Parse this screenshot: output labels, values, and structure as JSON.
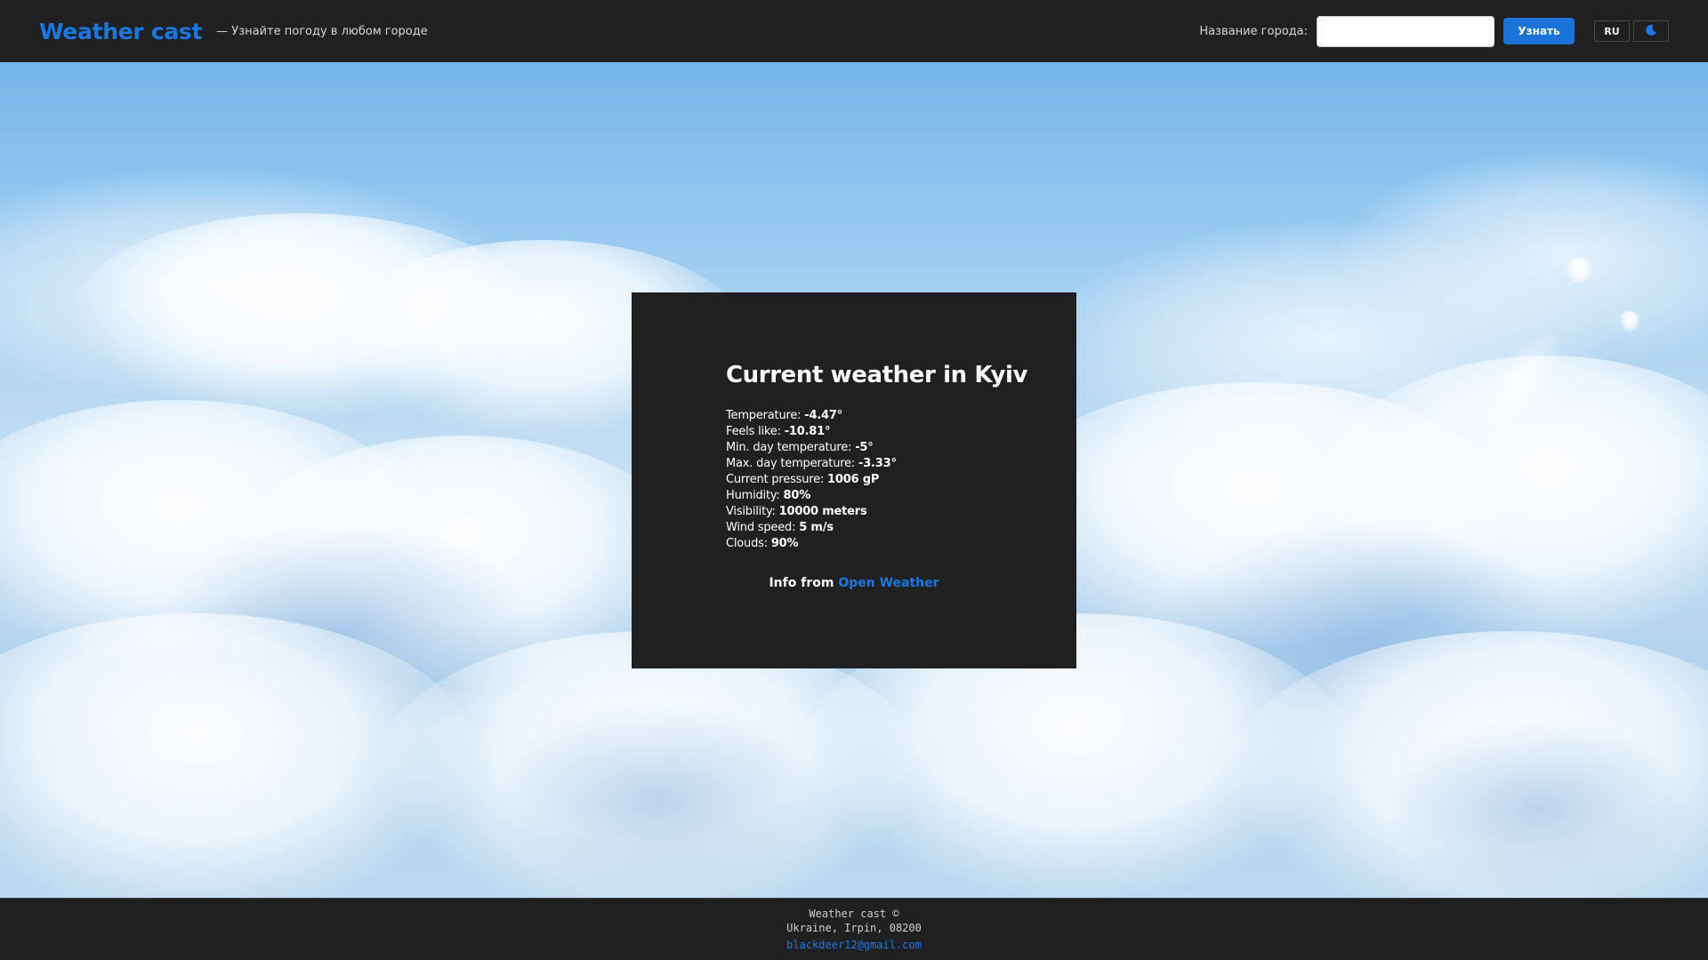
{
  "header": {
    "brand": "Weather cast",
    "tagline": "— Узнайте погоду в любом городе",
    "city_label": "Название города:",
    "city_input_value": "",
    "city_input_placeholder": "",
    "submit_label": "Узнать",
    "lang_label": "RU",
    "theme_icon": "moon-icon"
  },
  "weather": {
    "title": "Current weather in Kyiv",
    "stats": [
      {
        "label": "Temperature: ",
        "value": "-4.47°"
      },
      {
        "label": "Feels like: ",
        "value": "-10.81°"
      },
      {
        "label": "Min. day temperature: ",
        "value": "-5°"
      },
      {
        "label": "Max. day temperature: ",
        "value": "-3.33°"
      },
      {
        "label": "Current pressure: ",
        "value": "1006 gP"
      },
      {
        "label": "Humidity: ",
        "value": "80%"
      },
      {
        "label": "Visibility: ",
        "value": "10000 meters"
      },
      {
        "label": "Wind speed: ",
        "value": "5 m/s"
      },
      {
        "label": "Clouds: ",
        "value": "90%"
      }
    ],
    "source_prefix": "Info from ",
    "source_link": "Open Weather"
  },
  "footer": {
    "copyright": "Weather cast ©",
    "address": "Ukraine, Irpin, 08200",
    "email": "blackdeer12@gmail.com"
  },
  "colors": {
    "accent": "#1a78e0",
    "bar_background": "#202020",
    "card_background": "#202020"
  }
}
